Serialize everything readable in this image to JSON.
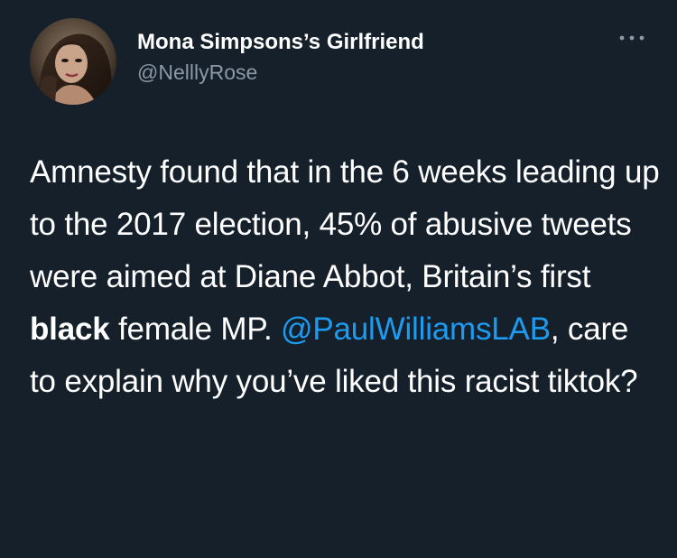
{
  "tweet": {
    "author": {
      "display_name": "Mona Simpsons’s Girlfriend",
      "handle": "@NelllyRose"
    },
    "more_icon": "ellipsis-icon",
    "text": {
      "part1": "Amnesty found that in the 6 weeks leading up to the 2017 election, 45% of abusive tweets were aimed at Diane Abbot, Britain’s first ",
      "bold": "black",
      "part2": " female MP. ",
      "mention": "@PaulWilliamsLAB",
      "part3": ", care to explain why you’ve liked this racist tiktok?"
    }
  },
  "colors": {
    "background": "#15202b",
    "text": "#ffffff",
    "secondary": "#8b98a5",
    "link": "#1d9bf0"
  }
}
